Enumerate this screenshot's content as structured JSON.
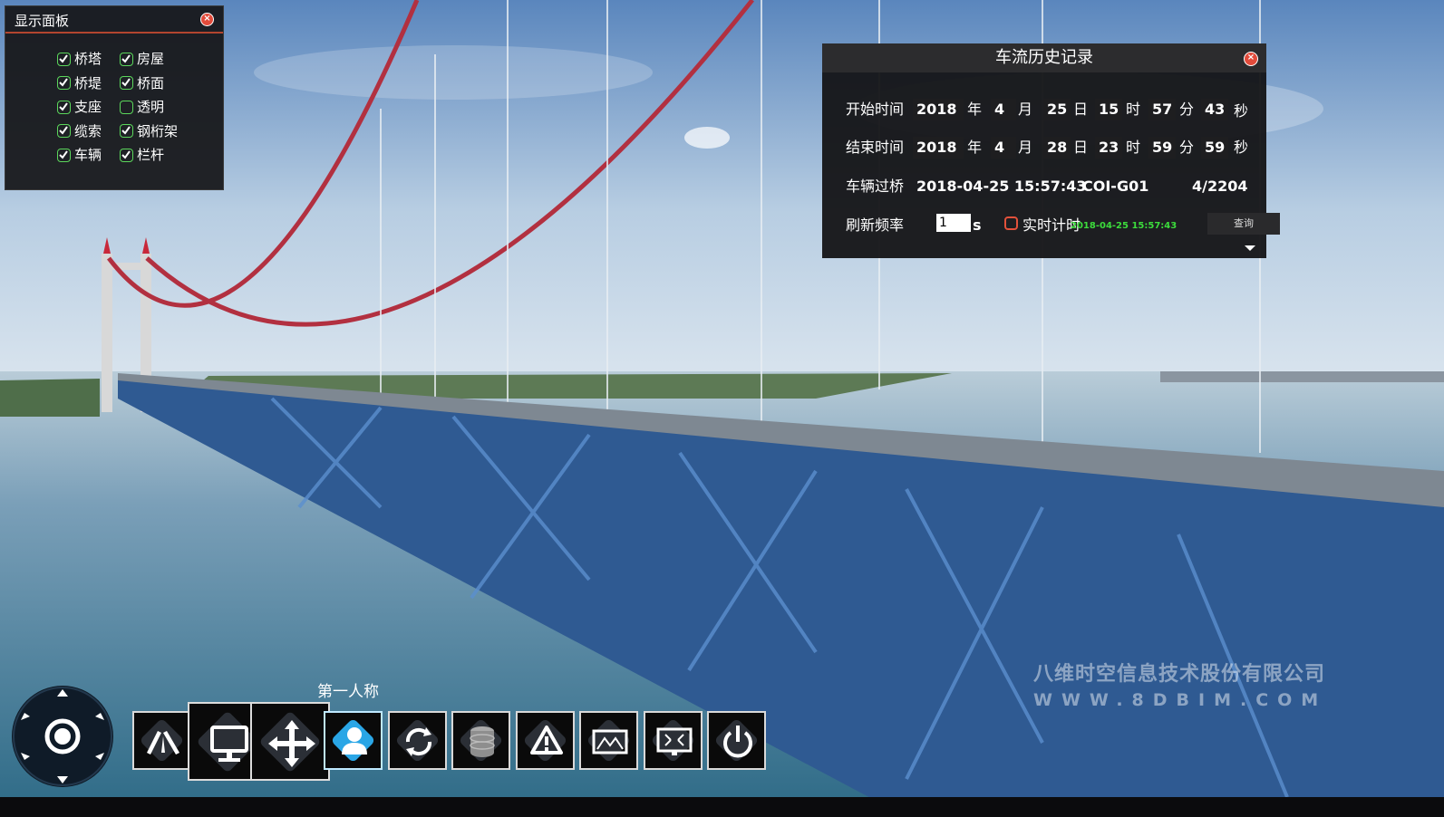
{
  "display_panel": {
    "title": "显示面板",
    "close_icon": "close-icon",
    "checkboxes": [
      {
        "label": "桥塔",
        "checked": true
      },
      {
        "label": "房屋",
        "checked": true
      },
      {
        "label": "桥堤",
        "checked": true
      },
      {
        "label": "桥面",
        "checked": true
      },
      {
        "label": "支座",
        "checked": true
      },
      {
        "label": "透明",
        "checked": false
      },
      {
        "label": "缆索",
        "checked": true
      },
      {
        "label": "钢桁架",
        "checked": true
      },
      {
        "label": "车辆",
        "checked": true
      },
      {
        "label": "栏杆",
        "checked": true
      }
    ]
  },
  "history_panel": {
    "title": "车流历史记录",
    "start": {
      "label": "开始时间",
      "year": "2018",
      "month": "4",
      "day": "25",
      "hour": "15",
      "minute": "57",
      "second": "43"
    },
    "end": {
      "label": "结束时间",
      "year": "2018",
      "month": "4",
      "day": "28",
      "hour": "23",
      "minute": "59",
      "second": "59"
    },
    "units": {
      "year": "年",
      "month": "月",
      "day": "日",
      "hour": "时",
      "minute": "分",
      "second": "秒"
    },
    "vehicle": {
      "label": "车辆过桥",
      "time": "2018-04-25 15:57:43",
      "id": "COI-G01",
      "count": "4/2204"
    },
    "refresh": {
      "label": "刷新频率",
      "value": "1",
      "unit": "s",
      "realtime_label": "实时计时",
      "realtime_checked": false,
      "clock": "2018-04-25 15:57:43",
      "query_label": "查询"
    },
    "accent_color": "#e2513b",
    "clock_color": "#3cdc3c"
  },
  "toolbar": {
    "active_label": "第一人称",
    "tools": [
      {
        "name": "measure-icon"
      },
      {
        "name": "monitor-icon"
      },
      {
        "name": "move-icon"
      },
      {
        "name": "person-icon",
        "active": true
      },
      {
        "name": "rotate-icon"
      },
      {
        "name": "database-icon"
      },
      {
        "name": "warning-icon"
      },
      {
        "name": "screen-layout-icon"
      },
      {
        "name": "fullscreen-icon"
      },
      {
        "name": "power-icon"
      }
    ]
  },
  "watermark": {
    "company": "八维时空信息技术股份有限公司",
    "url": "WWW.8DBIM.COM"
  }
}
